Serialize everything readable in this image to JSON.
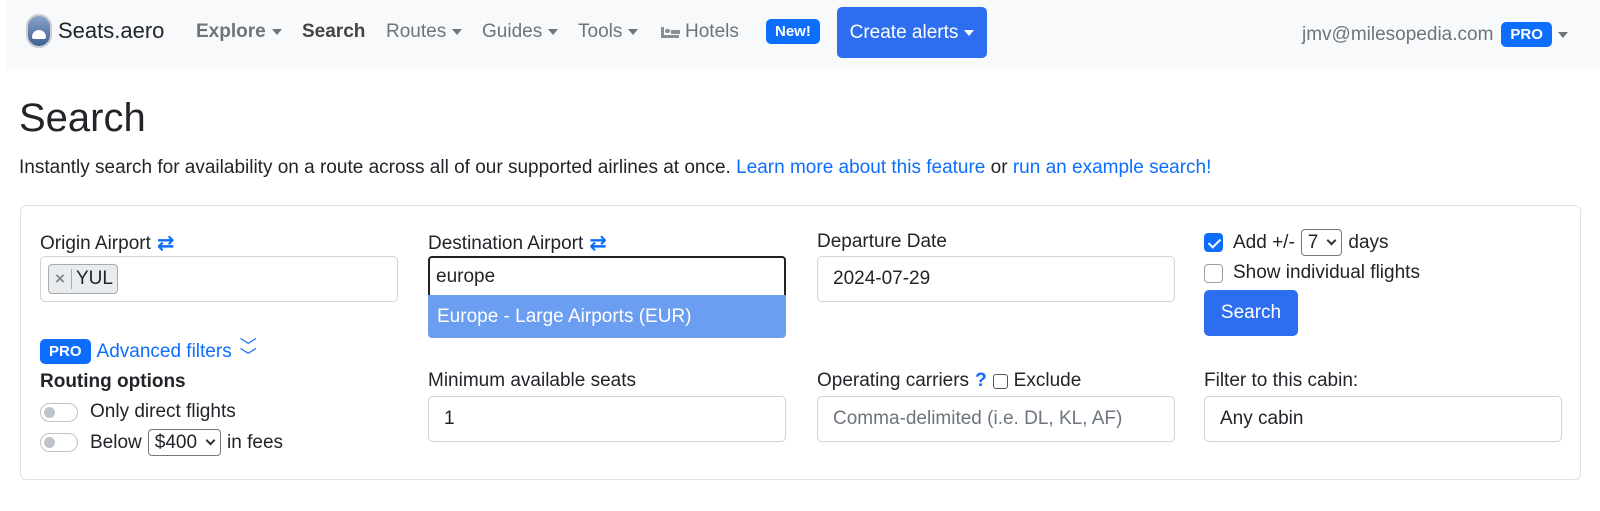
{
  "nav": {
    "brand": "Seats.aero",
    "explore": "Explore",
    "search": "Search",
    "routes": "Routes",
    "guides": "Guides",
    "tools": "Tools",
    "hotels": "Hotels",
    "new_badge": "New!",
    "create_alerts": "Create alerts",
    "user_email": "jmv@milesopedia.com",
    "pro_badge": "PRO"
  },
  "page": {
    "title": "Search",
    "intro_text": "Instantly search for availability on a route across all of our supported airlines at once.",
    "learn_more_link": "Learn more about this feature",
    "or_text": "or",
    "example_link": "run an example search!"
  },
  "form": {
    "origin_label": "Origin Airport",
    "origin_tag": "YUL",
    "destination_label": "Destination Airport",
    "destination_value": "europe",
    "destination_option": "Europe - Large Airports (EUR)",
    "date_label": "Departure Date",
    "date_value": "2024-07-29",
    "add_days_prefix": "Add +/-",
    "add_days_value": "7",
    "add_days_suffix": "days",
    "add_days_checked": true,
    "show_individual_label": "Show individual flights",
    "search_button": "Search",
    "pro_badge": "PRO",
    "advanced_filters_link": "Advanced filters",
    "routing_title": "Routing options",
    "direct_label": "Only direct flights",
    "below_prefix": "Below",
    "fee_value": "$400",
    "below_suffix": "in fees",
    "min_seats_label": "Minimum available seats",
    "min_seats_value": "1",
    "carriers_label": "Operating carriers",
    "carriers_help": "?",
    "exclude_label": "Exclude",
    "carriers_placeholder": "Comma-delimited (i.e. DL, KL, AF)",
    "cabin_label": "Filter to this cabin:",
    "cabin_value": "Any cabin"
  },
  "colors": {
    "primary": "#0d6efd",
    "button": "#2d6ef0",
    "dropdown_highlight": "#6b9df0",
    "navbar_bg": "#f8f9fa"
  },
  "icons": [
    "seats-aero-logo-icon",
    "bed-icon",
    "swap-arrows-icon",
    "chevron-down-icon",
    "double-chevron-down-icon",
    "remove-x-icon",
    "checkmark-icon"
  ]
}
